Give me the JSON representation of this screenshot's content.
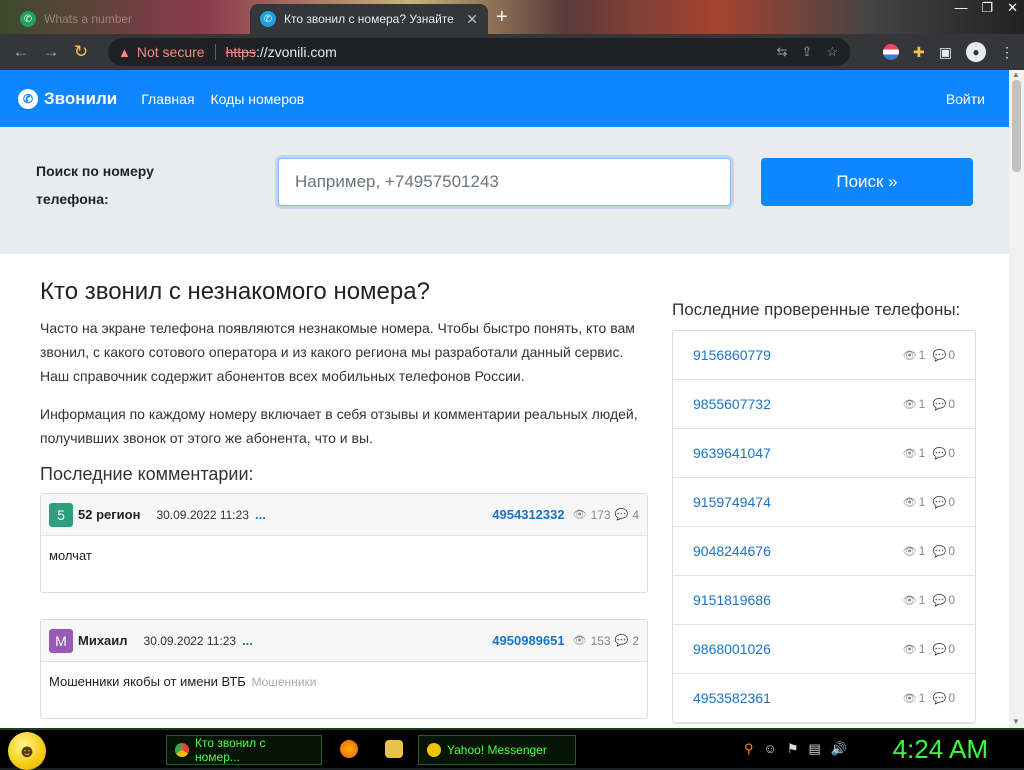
{
  "browser": {
    "tabs": [
      {
        "title": "Whats a number"
      },
      {
        "title": "Кто звонил с номера? Узнайте"
      }
    ],
    "address": {
      "security_label": "Not secure",
      "protocol": "https",
      "rest": "://zvonili.com"
    }
  },
  "site": {
    "brand": "Звонили",
    "nav": [
      "Главная",
      "Коды номеров"
    ],
    "login": "Войти",
    "search": {
      "label": "Поиск по номеру телефона:",
      "placeholder": "Например, +74957501243",
      "button": "Поиск »"
    },
    "headline": "Кто звонил с незнакомого номера?",
    "intro_1": "Часто на экране телефона появляются незнакомые номера. Чтобы быстро понять, кто вам звонил, с какого сотового оператора и из какого региона мы разработали данный сервис. Наш справочник содержит абонентов всех мобильных телефонов России.",
    "intro_2": "Информация по каждому номеру включает в себя отзывы и комментарии реальных людей, получивших звонок от этого же абонента, что и вы.",
    "comments_title": "Последние комментарии:",
    "comments": [
      {
        "avatar": "5",
        "avatar_color": "#2e9e7f",
        "name": "52 регион",
        "date": "30.09.2022 11:23",
        "more": "...",
        "phone": "4954312332",
        "views": "173",
        "replies": "4",
        "text": "молчат",
        "tag": ""
      },
      {
        "avatar": "М",
        "avatar_color": "#9b59b6",
        "name": "Михаил",
        "date": "30.09.2022 11:23",
        "more": "...",
        "phone": "4950989651",
        "views": "153",
        "replies": "2",
        "text": "Мошенники якобы от имени ВТБ",
        "tag": "Мошенники"
      }
    ],
    "side_title": "Последние проверенные телефоны:",
    "checked_phones": [
      {
        "number": "9156860779",
        "views": "1",
        "replies": "0"
      },
      {
        "number": "9855607732",
        "views": "1",
        "replies": "0"
      },
      {
        "number": "9639641047",
        "views": "1",
        "replies": "0"
      },
      {
        "number": "9159749474",
        "views": "1",
        "replies": "0"
      },
      {
        "number": "9048244676",
        "views": "1",
        "replies": "0"
      },
      {
        "number": "9151819686",
        "views": "1",
        "replies": "0"
      },
      {
        "number": "9868001026",
        "views": "1",
        "replies": "0"
      },
      {
        "number": "4953582361",
        "views": "1",
        "replies": "0"
      }
    ],
    "accent_color": "#0d86ff"
  },
  "taskbar": {
    "buttons": [
      {
        "label": "Кто звонил с номер..."
      },
      {
        "label": "Yahoo! Messenger"
      }
    ],
    "clock": "4:24 AM"
  }
}
